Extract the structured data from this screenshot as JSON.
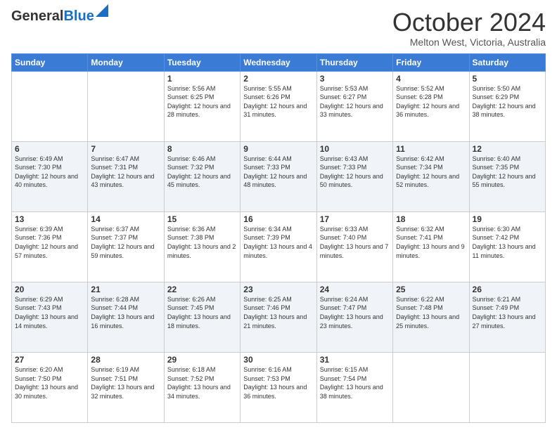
{
  "header": {
    "logo_general": "General",
    "logo_blue": "Blue",
    "month_title": "October 2024",
    "location": "Melton West, Victoria, Australia"
  },
  "days_of_week": [
    "Sunday",
    "Monday",
    "Tuesday",
    "Wednesday",
    "Thursday",
    "Friday",
    "Saturday"
  ],
  "weeks": [
    [
      {
        "day": "",
        "sunrise": "",
        "sunset": "",
        "daylight": ""
      },
      {
        "day": "",
        "sunrise": "",
        "sunset": "",
        "daylight": ""
      },
      {
        "day": "1",
        "sunrise": "Sunrise: 5:56 AM",
        "sunset": "Sunset: 6:25 PM",
        "daylight": "Daylight: 12 hours and 28 minutes."
      },
      {
        "day": "2",
        "sunrise": "Sunrise: 5:55 AM",
        "sunset": "Sunset: 6:26 PM",
        "daylight": "Daylight: 12 hours and 31 minutes."
      },
      {
        "day": "3",
        "sunrise": "Sunrise: 5:53 AM",
        "sunset": "Sunset: 6:27 PM",
        "daylight": "Daylight: 12 hours and 33 minutes."
      },
      {
        "day": "4",
        "sunrise": "Sunrise: 5:52 AM",
        "sunset": "Sunset: 6:28 PM",
        "daylight": "Daylight: 12 hours and 36 minutes."
      },
      {
        "day": "5",
        "sunrise": "Sunrise: 5:50 AM",
        "sunset": "Sunset: 6:29 PM",
        "daylight": "Daylight: 12 hours and 38 minutes."
      }
    ],
    [
      {
        "day": "6",
        "sunrise": "Sunrise: 6:49 AM",
        "sunset": "Sunset: 7:30 PM",
        "daylight": "Daylight: 12 hours and 40 minutes."
      },
      {
        "day": "7",
        "sunrise": "Sunrise: 6:47 AM",
        "sunset": "Sunset: 7:31 PM",
        "daylight": "Daylight: 12 hours and 43 minutes."
      },
      {
        "day": "8",
        "sunrise": "Sunrise: 6:46 AM",
        "sunset": "Sunset: 7:32 PM",
        "daylight": "Daylight: 12 hours and 45 minutes."
      },
      {
        "day": "9",
        "sunrise": "Sunrise: 6:44 AM",
        "sunset": "Sunset: 7:33 PM",
        "daylight": "Daylight: 12 hours and 48 minutes."
      },
      {
        "day": "10",
        "sunrise": "Sunrise: 6:43 AM",
        "sunset": "Sunset: 7:33 PM",
        "daylight": "Daylight: 12 hours and 50 minutes."
      },
      {
        "day": "11",
        "sunrise": "Sunrise: 6:42 AM",
        "sunset": "Sunset: 7:34 PM",
        "daylight": "Daylight: 12 hours and 52 minutes."
      },
      {
        "day": "12",
        "sunrise": "Sunrise: 6:40 AM",
        "sunset": "Sunset: 7:35 PM",
        "daylight": "Daylight: 12 hours and 55 minutes."
      }
    ],
    [
      {
        "day": "13",
        "sunrise": "Sunrise: 6:39 AM",
        "sunset": "Sunset: 7:36 PM",
        "daylight": "Daylight: 12 hours and 57 minutes."
      },
      {
        "day": "14",
        "sunrise": "Sunrise: 6:37 AM",
        "sunset": "Sunset: 7:37 PM",
        "daylight": "Daylight: 12 hours and 59 minutes."
      },
      {
        "day": "15",
        "sunrise": "Sunrise: 6:36 AM",
        "sunset": "Sunset: 7:38 PM",
        "daylight": "Daylight: 13 hours and 2 minutes."
      },
      {
        "day": "16",
        "sunrise": "Sunrise: 6:34 AM",
        "sunset": "Sunset: 7:39 PM",
        "daylight": "Daylight: 13 hours and 4 minutes."
      },
      {
        "day": "17",
        "sunrise": "Sunrise: 6:33 AM",
        "sunset": "Sunset: 7:40 PM",
        "daylight": "Daylight: 13 hours and 7 minutes."
      },
      {
        "day": "18",
        "sunrise": "Sunrise: 6:32 AM",
        "sunset": "Sunset: 7:41 PM",
        "daylight": "Daylight: 13 hours and 9 minutes."
      },
      {
        "day": "19",
        "sunrise": "Sunrise: 6:30 AM",
        "sunset": "Sunset: 7:42 PM",
        "daylight": "Daylight: 13 hours and 11 minutes."
      }
    ],
    [
      {
        "day": "20",
        "sunrise": "Sunrise: 6:29 AM",
        "sunset": "Sunset: 7:43 PM",
        "daylight": "Daylight: 13 hours and 14 minutes."
      },
      {
        "day": "21",
        "sunrise": "Sunrise: 6:28 AM",
        "sunset": "Sunset: 7:44 PM",
        "daylight": "Daylight: 13 hours and 16 minutes."
      },
      {
        "day": "22",
        "sunrise": "Sunrise: 6:26 AM",
        "sunset": "Sunset: 7:45 PM",
        "daylight": "Daylight: 13 hours and 18 minutes."
      },
      {
        "day": "23",
        "sunrise": "Sunrise: 6:25 AM",
        "sunset": "Sunset: 7:46 PM",
        "daylight": "Daylight: 13 hours and 21 minutes."
      },
      {
        "day": "24",
        "sunrise": "Sunrise: 6:24 AM",
        "sunset": "Sunset: 7:47 PM",
        "daylight": "Daylight: 13 hours and 23 minutes."
      },
      {
        "day": "25",
        "sunrise": "Sunrise: 6:22 AM",
        "sunset": "Sunset: 7:48 PM",
        "daylight": "Daylight: 13 hours and 25 minutes."
      },
      {
        "day": "26",
        "sunrise": "Sunrise: 6:21 AM",
        "sunset": "Sunset: 7:49 PM",
        "daylight": "Daylight: 13 hours and 27 minutes."
      }
    ],
    [
      {
        "day": "27",
        "sunrise": "Sunrise: 6:20 AM",
        "sunset": "Sunset: 7:50 PM",
        "daylight": "Daylight: 13 hours and 30 minutes."
      },
      {
        "day": "28",
        "sunrise": "Sunrise: 6:19 AM",
        "sunset": "Sunset: 7:51 PM",
        "daylight": "Daylight: 13 hours and 32 minutes."
      },
      {
        "day": "29",
        "sunrise": "Sunrise: 6:18 AM",
        "sunset": "Sunset: 7:52 PM",
        "daylight": "Daylight: 13 hours and 34 minutes."
      },
      {
        "day": "30",
        "sunrise": "Sunrise: 6:16 AM",
        "sunset": "Sunset: 7:53 PM",
        "daylight": "Daylight: 13 hours and 36 minutes."
      },
      {
        "day": "31",
        "sunrise": "Sunrise: 6:15 AM",
        "sunset": "Sunset: 7:54 PM",
        "daylight": "Daylight: 13 hours and 38 minutes."
      },
      {
        "day": "",
        "sunrise": "",
        "sunset": "",
        "daylight": ""
      },
      {
        "day": "",
        "sunrise": "",
        "sunset": "",
        "daylight": ""
      }
    ]
  ]
}
